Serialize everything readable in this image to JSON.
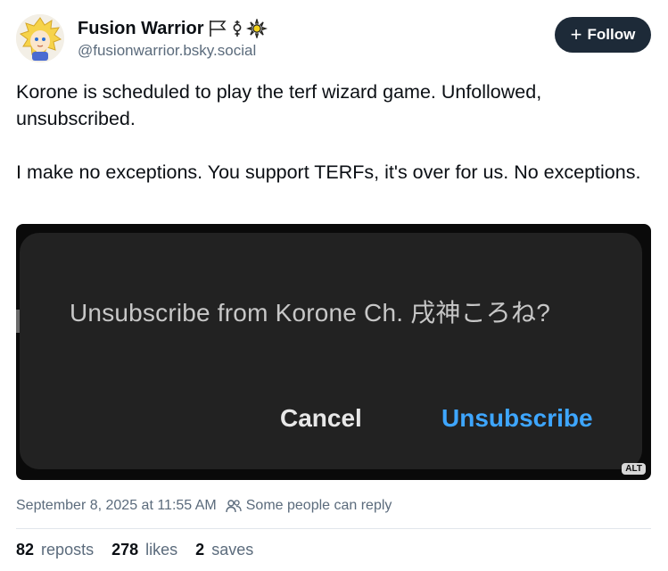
{
  "author": {
    "display_name": "Fusion Warrior",
    "handle": "@fusionwarrior.bsky.social",
    "name_icons": [
      "flag-icon",
      "transgender-symbol-icon",
      "sun-icon"
    ]
  },
  "follow_button": {
    "label": "Follow",
    "icon": "plus-icon"
  },
  "post": {
    "paragraphs": [
      "Korone is scheduled to play the terf wizard game. Unfollowed, unsubscribed.",
      "I make no exceptions. You support TERFs, it's over for us. No exceptions."
    ]
  },
  "media": {
    "dialog_title": "Unsubscribe from Korone Ch. 戌神ころね?",
    "cancel_label": "Cancel",
    "confirm_label": "Unsubscribe",
    "alt_badge": "ALT"
  },
  "meta": {
    "timestamp": "September 8, 2025 at 11:55 AM",
    "reply_setting": "Some people can reply",
    "reply_icon": "people-icon"
  },
  "stats": {
    "reposts_count": "82",
    "reposts_label": "reposts",
    "likes_count": "278",
    "likes_label": "likes",
    "saves_count": "2",
    "saves_label": "saves"
  },
  "colors": {
    "follow_bg": "#1d2a38",
    "muted_text": "#5b6b7c",
    "dialog_accent": "#3ea6ff"
  }
}
